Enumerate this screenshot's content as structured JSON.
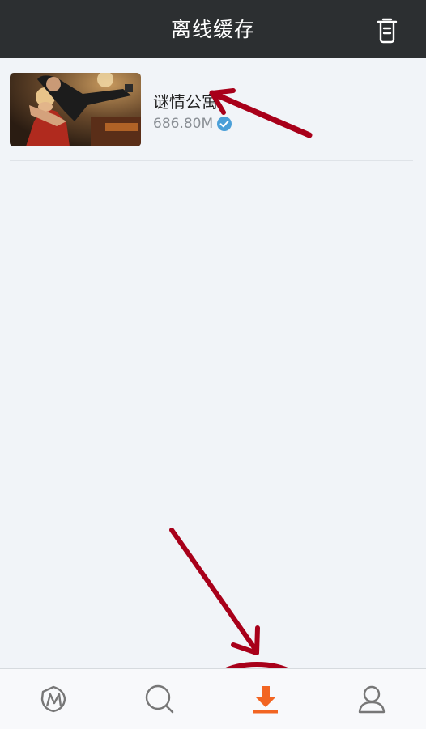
{
  "header": {
    "title": "离线缓存",
    "trash_icon": "trash-icon"
  },
  "downloads": [
    {
      "title": "谜情公寓",
      "size": "686.80M",
      "status_icon": "check-circle-icon"
    }
  ],
  "tabbar": {
    "items": [
      {
        "icon": "video-logo-icon"
      },
      {
        "icon": "search-icon"
      },
      {
        "icon": "download-icon",
        "active": true
      },
      {
        "icon": "profile-icon"
      }
    ]
  },
  "colors": {
    "header_bg": "#2c2f31",
    "accent": "#f26522",
    "check": "#4a9fd8",
    "annotation": "#a8001a"
  }
}
